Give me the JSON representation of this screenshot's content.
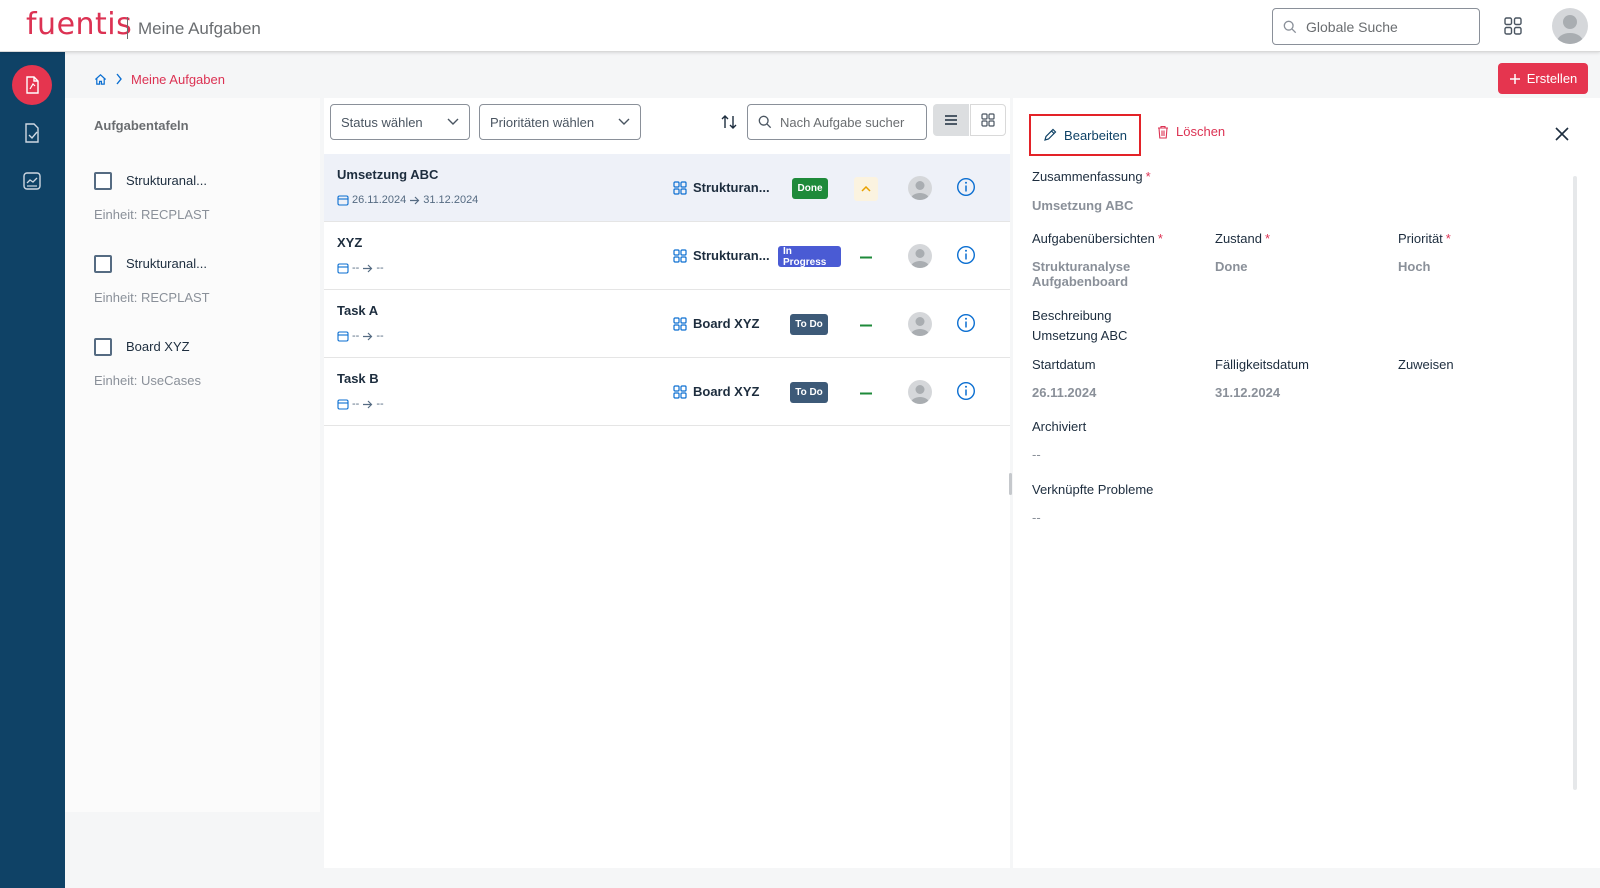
{
  "app": {
    "logo": "fuentis",
    "title": "Meine Aufgaben",
    "global_search_placeholder": "Globale Suche"
  },
  "breadcrumb": {
    "current": "Meine Aufgaben"
  },
  "toolbar": {
    "create_label": "Erstellen"
  },
  "boards": {
    "title": "Aufgabentafeln",
    "items": [
      {
        "name": "Strukturanal...",
        "unit": "Einheit: RECPLAST"
      },
      {
        "name": "Strukturanal...",
        "unit": "Einheit: RECPLAST"
      },
      {
        "name": "Board XYZ",
        "unit": "Einheit: UseCases"
      }
    ]
  },
  "filters": {
    "status_placeholder": "Status wählen",
    "priority_placeholder": "Prioritäten wählen",
    "search_placeholder": "Nach Aufgabe sucher"
  },
  "tasks": [
    {
      "title": "Umsetzung ABC",
      "start": "26.11.2024",
      "end": "31.12.2024",
      "board": "Strukturan...",
      "status": "Done",
      "status_color": "#1e8a3a",
      "priority": "Hoch"
    },
    {
      "title": "XYZ",
      "start": "--",
      "end": "--",
      "board": "Strukturan...",
      "status": "In Progress",
      "status_color": "#4a5bd4",
      "priority": "Mittel"
    },
    {
      "title": "Task A",
      "start": "--",
      "end": "--",
      "board": "Board XYZ",
      "status": "To Do",
      "status_color": "#3d5a78",
      "priority": "Mittel"
    },
    {
      "title": "Task B",
      "start": "--",
      "end": "--",
      "board": "Board XYZ",
      "status": "To Do",
      "status_color": "#3d5a78",
      "priority": "Mittel"
    }
  ],
  "detail": {
    "edit_label": "Bearbeiten",
    "delete_label": "Löschen",
    "summary_label": "Zusammenfassung",
    "summary_value": "Umsetzung ABC",
    "overview_label": "Aufgabenübersichten",
    "overview_value": "Strukturanalyse Aufgabenboard",
    "state_label": "Zustand",
    "state_value": "Done",
    "priority_label": "Priorität",
    "priority_value": "Hoch",
    "description_label": "Beschreibung",
    "description_value": "Umsetzung ABC",
    "start_label": "Startdatum",
    "start_value": "26.11.2024",
    "due_label": "Fälligkeitsdatum",
    "due_value": "31.12.2024",
    "assign_label": "Zuweisen",
    "archived_label": "Archiviert",
    "archived_value": "--",
    "linked_label": "Verknüpfte Probleme",
    "linked_value": "--",
    "required_mark": "*"
  },
  "colors": {
    "brand": "#dc3253",
    "rail": "#0f4266",
    "accent_blue": "#0a6ed1"
  }
}
